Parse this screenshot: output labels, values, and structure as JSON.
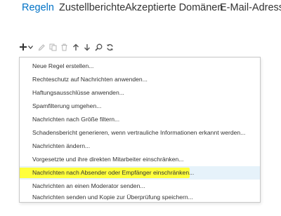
{
  "tabs": [
    {
      "label": "Regeln",
      "active": true
    },
    {
      "label": "Zustellberichte",
      "active": false
    },
    {
      "label": "Akzeptierte Domänen",
      "active": false
    },
    {
      "label": "E-Mail-Adressrichtlinien",
      "active": false
    }
  ],
  "toolbar": {
    "icons": [
      "plus-icon",
      "chevron-down-icon",
      "pencil-icon",
      "copy-icon",
      "trash-icon",
      "arrow-up-icon",
      "arrow-down-icon",
      "search-icon",
      "refresh-icon"
    ]
  },
  "menu": {
    "items": [
      {
        "label": "Neue Regel erstellen..."
      },
      {
        "label": "Rechteschutz auf Nachrichten anwenden..."
      },
      {
        "label": "Haftungsausschlüsse anwenden..."
      },
      {
        "label": "Spamfilterung umgehen..."
      },
      {
        "label": "Nachrichten nach Größe filtern..."
      },
      {
        "label": "Schadensbericht generieren, wenn vertrauliche Informationen erkannt werden..."
      },
      {
        "label": "Nachrichten ändern..."
      },
      {
        "label": "Vorgesetzte und ihre direkten Mitarbeiter einschränken..."
      },
      {
        "label": "Nachrichten nach Absender oder Empfänger einschränken...",
        "selected": true,
        "highlighted": true
      },
      {
        "label": "Nachrichten an einen Moderator senden..."
      },
      {
        "label": "Nachrichten senden und Kopie zur Überprüfung speichern..."
      }
    ],
    "highlight_color": "#ffff3c",
    "selected_bg": "#e6f2fa"
  },
  "colors": {
    "accent": "#0072c6",
    "text": "#333333"
  }
}
